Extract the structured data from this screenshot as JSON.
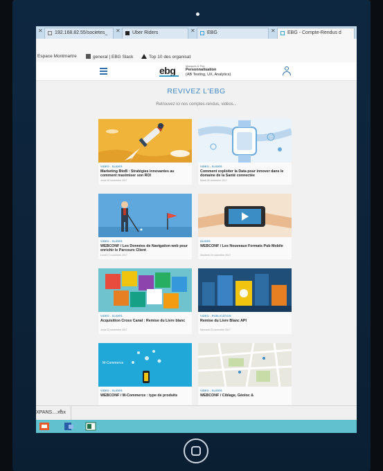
{
  "browser": {
    "tabs": [
      {
        "label": "192.168.82.55/societes_"
      },
      {
        "label": "Uber Riders"
      },
      {
        "label": "EBG"
      },
      {
        "label": "EBG - Compte-Rendus d"
      }
    ],
    "bookmarks": [
      {
        "label": "Espace Montmartre"
      },
      {
        "label": "general | EBG Slack"
      },
      {
        "label": "Top 10 des organisat"
      }
    ]
  },
  "site": {
    "logo": "ebg",
    "header_small": "Marques & Pub",
    "header_title": "Personnalisation",
    "header_subtitle": "(AB Testing, UX, Analytics)",
    "heading": "REVIVEZ L'EBG",
    "subheading": "Retrouvez ici nos comptes-rendus, vidéos...",
    "cards": [
      {
        "tag": "VIDEO - SLIDES",
        "title": "Marketing BtoB : Stratégies innovantes au comment maximiser son ROI",
        "date": "Jeudi 30 novembre 2017"
      },
      {
        "tag": "VIDEO - SLIDES",
        "title": "Comment exploiter la Data pour innover dans le domaine de la Santé connectée",
        "date": "Mardi 28 novembre 2017"
      },
      {
        "tag": "VIDEO - SLIDES",
        "title": "WEBCONF / Les Données de Navigation web pour enrichir le Parcours Client",
        "date": "Lundi 27 novembre 2017"
      },
      {
        "tag": "SLIDES",
        "title": "WEBCONF / Les Nouveaux Formats Pub Mobile",
        "date": "Vendredi 24 novembre 2017"
      },
      {
        "tag": "VIDEO - SLIDES",
        "title": "Acquisition Cross Canal : Remise du Livre blanc",
        "date": "Jeudi 23 novembre 2017"
      },
      {
        "tag": "VIDEO - PUBLICATION",
        "title": "Remise du Livre Blanc API",
        "date": "Mercredi 22 novembre 2017"
      },
      {
        "tag": "VIDEO - SLIDES",
        "title": "WEBCONF / M-Commerce : type de produits",
        "date": "",
        "thumb_text": "M-Commerce"
      },
      {
        "tag": "VIDEO - SLIDES",
        "title": "WEBCONF / Ciblage, Géoloc &",
        "date": ""
      }
    ]
  },
  "downloads": {
    "file": "XPANS....xlsx",
    "chevron": "^"
  },
  "colors": {
    "accent": "#3d86c4",
    "taskbar": "#62c1cf",
    "bezel": "#0e2740"
  }
}
